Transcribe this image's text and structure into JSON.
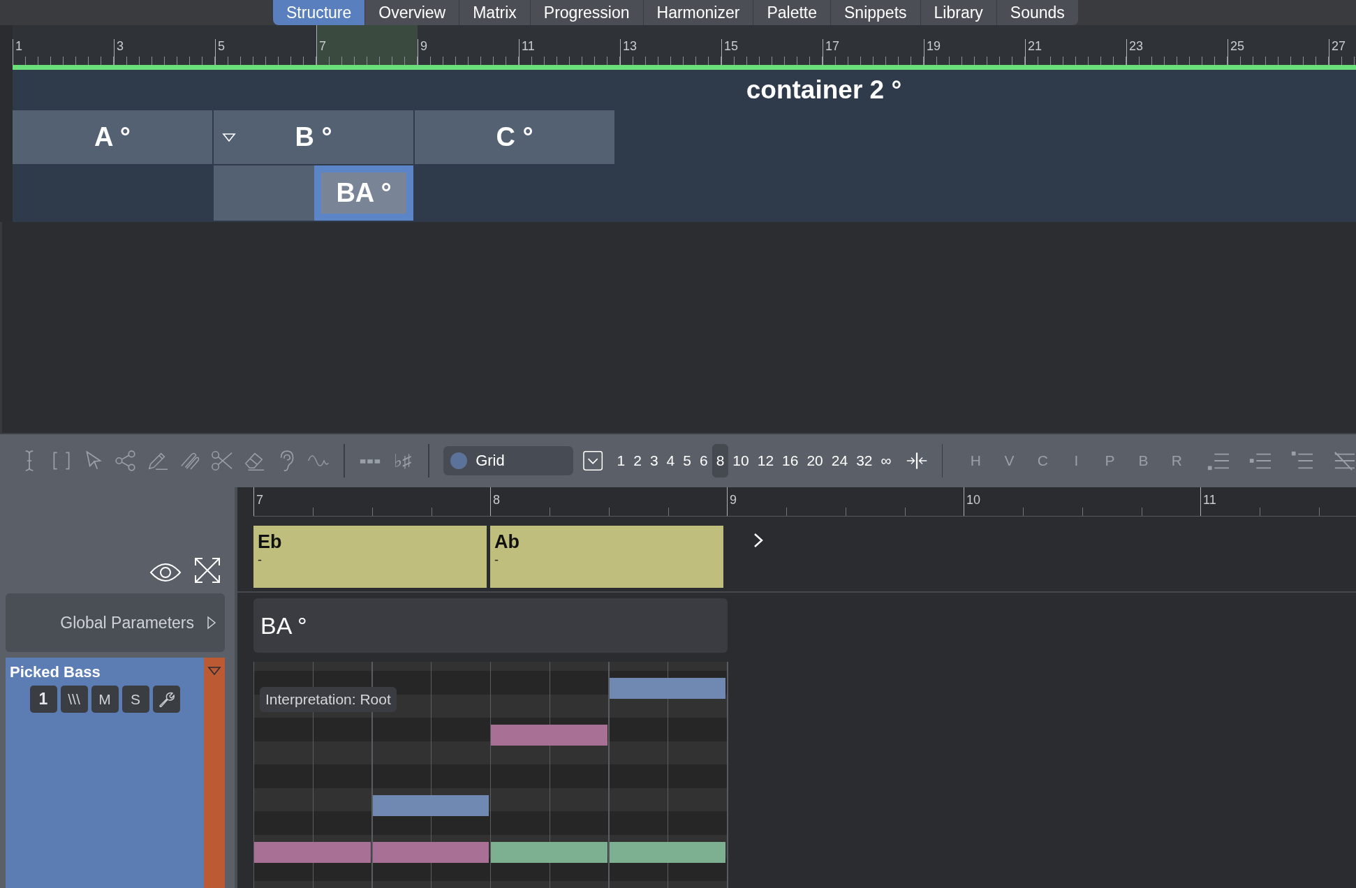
{
  "tabs": [
    {
      "label": "Structure",
      "selected": true
    },
    {
      "label": "Overview",
      "selected": false
    },
    {
      "label": "Matrix",
      "selected": false
    },
    {
      "label": "Progression",
      "selected": false
    },
    {
      "label": "Harmonizer",
      "selected": false
    },
    {
      "label": "Palette",
      "selected": false
    },
    {
      "label": "Snippets",
      "selected": false
    },
    {
      "label": "Library",
      "selected": false
    },
    {
      "label": "Sounds",
      "selected": false
    }
  ],
  "timeline": {
    "ruler": [
      {
        "label": "1",
        "selected": false
      },
      {
        "label": "3",
        "selected": false
      },
      {
        "label": "5",
        "selected": false
      },
      {
        "label": "7",
        "selected": true
      },
      {
        "label": "9",
        "selected": false
      },
      {
        "label": "11",
        "selected": false
      },
      {
        "label": "13",
        "selected": false
      },
      {
        "label": "15",
        "selected": false
      },
      {
        "label": "17",
        "selected": false
      },
      {
        "label": "19",
        "selected": false
      },
      {
        "label": "21",
        "selected": false
      },
      {
        "label": "23",
        "selected": false
      },
      {
        "label": "25",
        "selected": false
      },
      {
        "label": "27",
        "selected": false
      }
    ]
  },
  "structure": {
    "container": {
      "title": "container 2 °"
    },
    "sections": [
      {
        "label": "A °",
        "expanded": false,
        "selected": false
      },
      {
        "label": "B °",
        "expanded": true,
        "selected": false,
        "children": [
          {
            "label": "BA °",
            "selected": true
          }
        ]
      },
      {
        "label": "C °",
        "expanded": false,
        "selected": false
      }
    ]
  },
  "toolbar": {
    "accidentals": {
      "label": "♭♯"
    },
    "grid": {
      "label": "Grid"
    },
    "grid_values": [
      {
        "label": "1",
        "selected": false
      },
      {
        "label": "2",
        "selected": false
      },
      {
        "label": "3",
        "selected": false
      },
      {
        "label": "4",
        "selected": false
      },
      {
        "label": "5",
        "selected": false
      },
      {
        "label": "6",
        "selected": false
      },
      {
        "label": "8",
        "selected": true
      },
      {
        "label": "10",
        "selected": false
      },
      {
        "label": "12",
        "selected": false
      },
      {
        "label": "16",
        "selected": false
      },
      {
        "label": "20",
        "selected": false
      },
      {
        "label": "24",
        "selected": false
      },
      {
        "label": "32",
        "selected": false
      },
      {
        "label": "∞",
        "selected": false
      }
    ],
    "modes": [
      {
        "label": "H",
        "disabled": true
      },
      {
        "label": "V",
        "disabled": true
      },
      {
        "label": "C",
        "disabled": true
      },
      {
        "label": "I",
        "disabled": true
      },
      {
        "label": "P",
        "disabled": true
      },
      {
        "label": "B",
        "disabled": true
      },
      {
        "label": "R",
        "disabled": true
      }
    ]
  },
  "sidebar": {
    "global_parameters": {
      "label": "Global Parameters",
      "expanded": false
    },
    "track": {
      "name": "Picked Bass",
      "expanded": true,
      "buttons": [
        {
          "kind": "text",
          "label": "1"
        },
        {
          "kind": "text",
          "label": "\\\\\\"
        },
        {
          "kind": "text",
          "label": "M"
        },
        {
          "kind": "text",
          "label": "S"
        },
        {
          "kind": "wrench"
        }
      ]
    }
  },
  "editor": {
    "ruler": [
      "7",
      "8",
      "9",
      "10",
      "11"
    ],
    "chords": [
      {
        "name": "Eb",
        "detail": "-"
      },
      {
        "name": "Ab",
        "detail": "-"
      }
    ],
    "section_title": "BA °",
    "tooltip": "Interpretation: Root"
  }
}
